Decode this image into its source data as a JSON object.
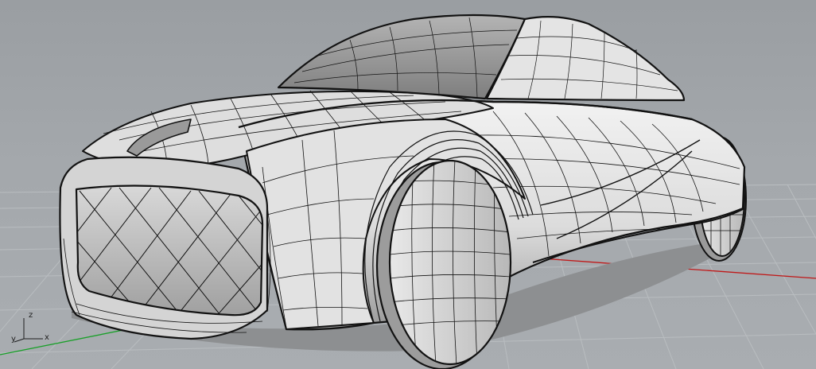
{
  "viewport": {
    "background_color": "#a2a6aa",
    "grid_color": "#b8bcbf",
    "x_axis_color": "#c01010",
    "y_axis_color": "#10a020"
  },
  "model": {
    "fill_color": "#e6e6e6",
    "shade_color": "#8c8c8c",
    "edge_color": "#111111",
    "isocurve_color": "#202020"
  },
  "axis_widget": {
    "z_label": "z",
    "y_label": "y",
    "x_label": "x"
  }
}
